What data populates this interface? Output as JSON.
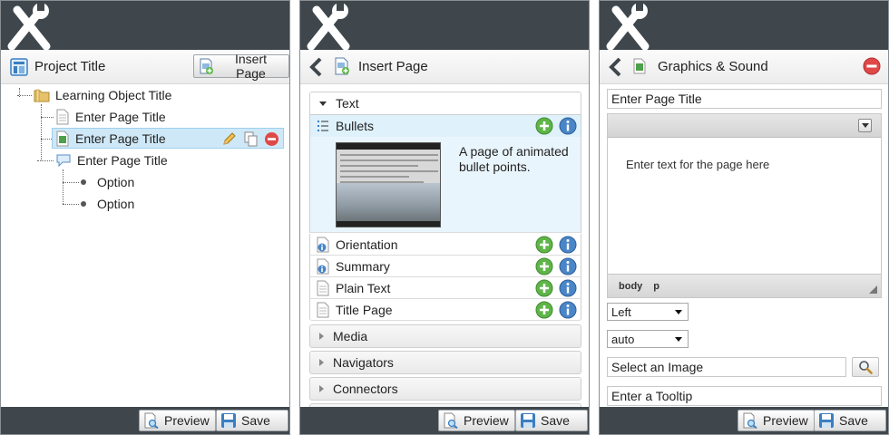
{
  "colors": {
    "topbar": "#3f474c",
    "selection": "#cfe8f7",
    "add_green": "#5fb548",
    "info_blue": "#4a86c7",
    "delete_red": "#e04848"
  },
  "panel1": {
    "title": "Project Title",
    "insert_page_label": "Insert Page",
    "tree": {
      "root": "Learning Object Title",
      "pages": [
        {
          "label": "Enter Page Title",
          "icon": "page-icon"
        },
        {
          "label": "Enter Page Title",
          "icon": "graphics-page-icon",
          "selected": true
        },
        {
          "label": "Enter Page Title",
          "icon": "speech-bubble-icon"
        }
      ],
      "options": [
        "Option",
        "Option"
      ]
    },
    "footer": {
      "preview": "Preview",
      "save": "Save"
    }
  },
  "panel2": {
    "title": "Insert Page",
    "open_category": "Text",
    "items": [
      {
        "label": "Bullets",
        "icon": "bullets-icon",
        "selected": true
      },
      {
        "label": "Orientation",
        "icon": "info-page-icon"
      },
      {
        "label": "Summary",
        "icon": "info-page-icon"
      },
      {
        "label": "Plain Text",
        "icon": "page-icon"
      },
      {
        "label": "Title Page",
        "icon": "page-icon"
      }
    ],
    "bullets_description": "A page of animated bullet points.",
    "closed_categories": [
      "Media",
      "Navigators",
      "Connectors"
    ],
    "footer": {
      "preview": "Preview",
      "save": "Save"
    }
  },
  "panel3": {
    "title": "Graphics & Sound",
    "page_title_value": "Enter Page Title",
    "editor_placeholder": "Enter text for the page here",
    "editor_path": [
      "body",
      "p"
    ],
    "align_value": "Left",
    "size_value": "auto",
    "image_value": "Select an Image",
    "tooltip_value": "Enter a Tooltip",
    "footer": {
      "preview": "Preview",
      "save": "Save"
    }
  }
}
